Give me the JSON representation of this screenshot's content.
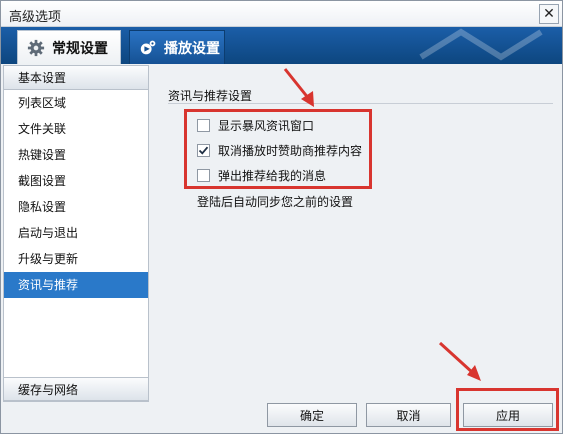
{
  "window": {
    "title": "高级选项"
  },
  "tabs": [
    {
      "label": "常规设置",
      "active": true,
      "icon": "gear-icon"
    },
    {
      "label": "播放设置",
      "active": false,
      "icon": "playback-settings-icon"
    }
  ],
  "sidebar": {
    "items": [
      {
        "label": "基本设置",
        "type": "header"
      },
      {
        "label": "列表区域"
      },
      {
        "label": "文件关联"
      },
      {
        "label": "热键设置"
      },
      {
        "label": "截图设置"
      },
      {
        "label": "隐私设置"
      },
      {
        "label": "启动与退出"
      },
      {
        "label": "升级与更新"
      },
      {
        "label": "资讯与推荐",
        "selected": true
      }
    ],
    "footer": "缓存与网络"
  },
  "section": {
    "title": "资讯与推荐设置",
    "options": [
      {
        "label": "显示暴风资讯窗口",
        "checked": false
      },
      {
        "label": "取消播放时赞助商推荐内容",
        "checked": true
      },
      {
        "label": "弹出推荐给我的消息",
        "checked": false
      }
    ],
    "note": "登陆后自动同步您之前的设置"
  },
  "buttons": {
    "ok": "确定",
    "cancel": "取消",
    "apply": "应用"
  },
  "colors": {
    "accent": "#2a79c9",
    "tabbar": "#1b5ea8",
    "highlight": "#d8352f"
  }
}
